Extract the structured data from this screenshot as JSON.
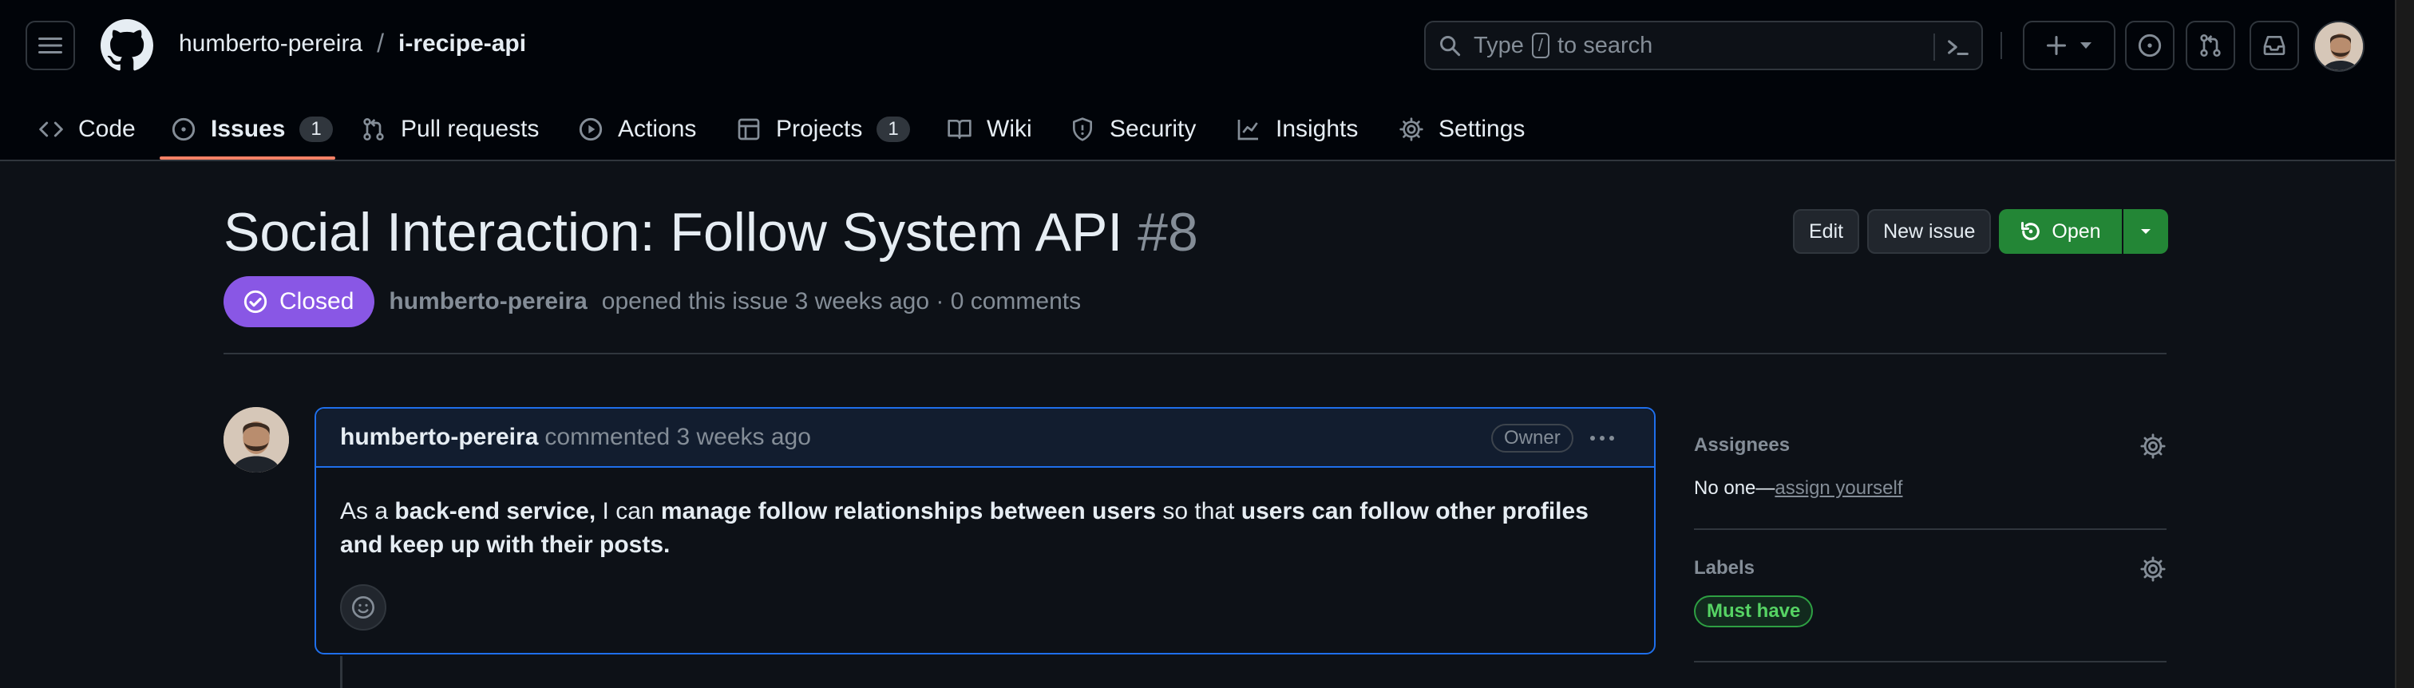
{
  "header": {
    "owner": "humberto-pereira",
    "separator": "/",
    "repo": "i-recipe-api",
    "search": {
      "prefix": "Type",
      "key": "/",
      "suffix": "to search"
    }
  },
  "nav": {
    "code": "Code",
    "issues": "Issues",
    "issues_count": "1",
    "pulls": "Pull requests",
    "actions": "Actions",
    "projects": "Projects",
    "projects_count": "1",
    "wiki": "Wiki",
    "security": "Security",
    "insights": "Insights",
    "settings": "Settings"
  },
  "issue": {
    "title": "Social Interaction: Follow System API",
    "number": "#8",
    "state": "Closed",
    "author": "humberto-pereira",
    "meta": "opened this issue 3 weeks ago · 0 comments",
    "buttons": {
      "edit": "Edit",
      "new_issue": "New issue",
      "open": "Open"
    }
  },
  "comment": {
    "author": "humberto-pereira",
    "time": "commented 3 weeks ago",
    "role": "Owner",
    "body": {
      "p1": "As a ",
      "b1": "back-end service,",
      "p2": " I can ",
      "b2": "manage follow relationships between users",
      "p3": " so that ",
      "b3": "users can follow other profiles and keep up with their posts."
    }
  },
  "sidebar": {
    "assignees_title": "Assignees",
    "assignees_none": "No one—",
    "assignees_link": "assign yourself",
    "labels_title": "Labels",
    "label": "Must have"
  },
  "colors": {
    "background": "#0d1117",
    "closed_badge": "#8957e5",
    "open_button": "#238636",
    "active_tab": "#f78166",
    "label_green": "#56d364"
  }
}
